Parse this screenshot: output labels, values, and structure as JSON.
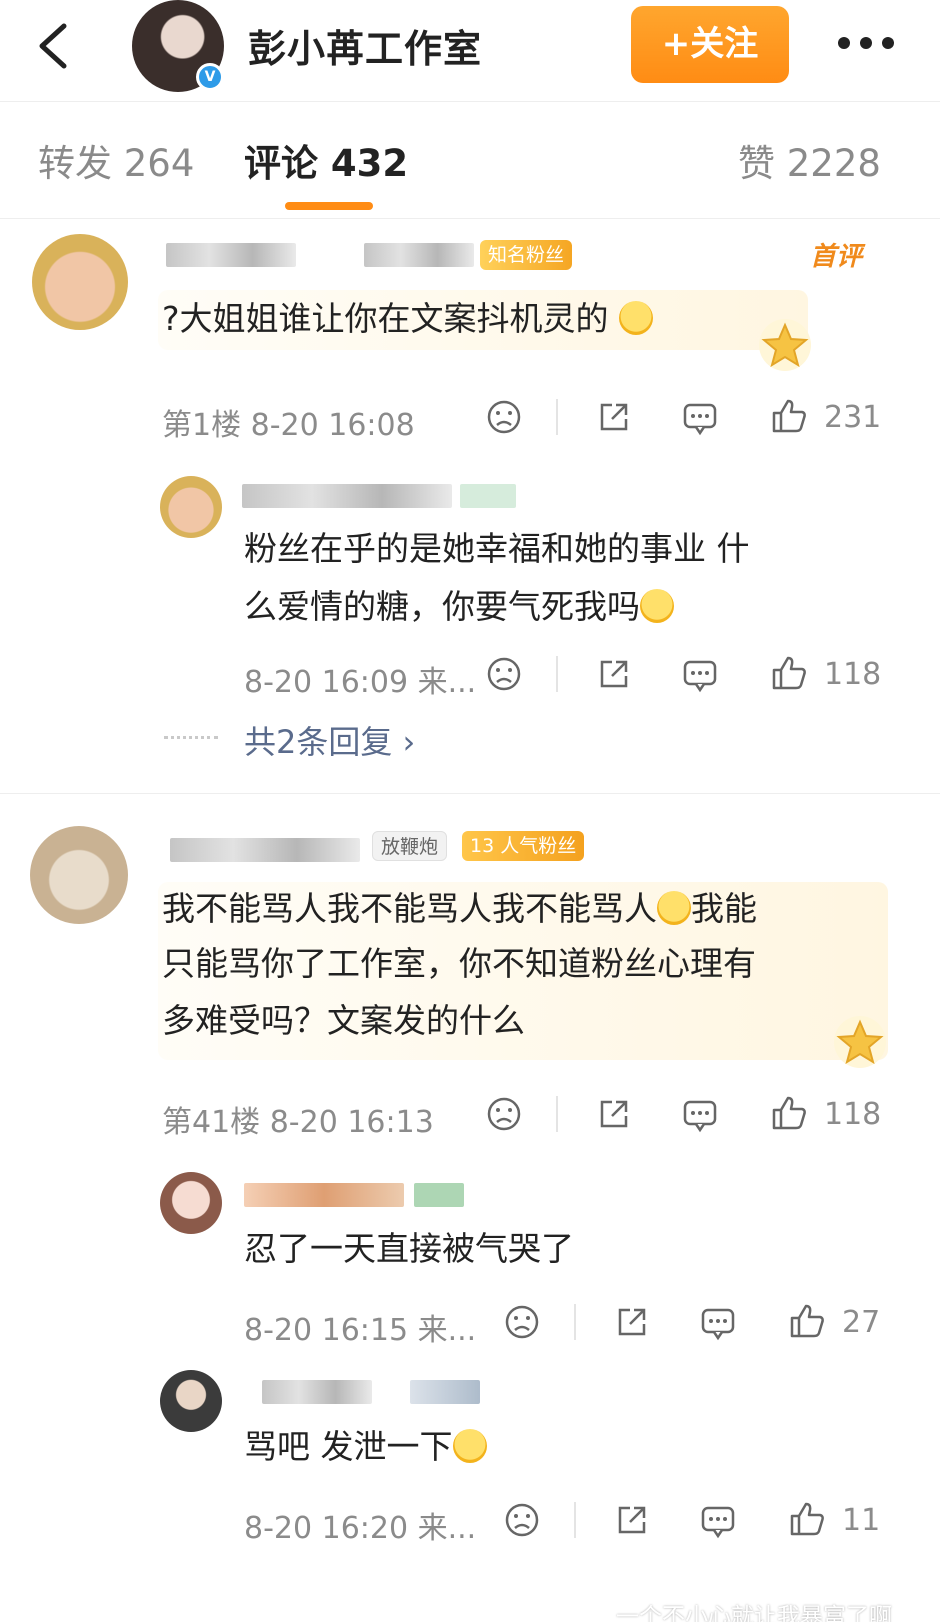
{
  "header": {
    "title": "彭小苒工作室",
    "follow_label": "+关注",
    "verified_mark": "V"
  },
  "tabs": [
    {
      "label": "转发 264"
    },
    {
      "label": "评论 432"
    },
    {
      "label": "赞 2228"
    }
  ],
  "comments": [
    {
      "badge": "知名粉丝",
      "first_tag": "首评",
      "text": "?大姐姐谁让你在文案抖机灵的",
      "meta": "第1楼 8-20 16:08",
      "likes": "231",
      "replies": [
        {
          "text_line1": "粉丝在乎的是她幸福和她的事业  什",
          "text_line2": "么爱情的糖，你要气死我吗",
          "meta": "8-20 16:09 来...",
          "likes": "118"
        }
      ],
      "more_replies": "共2条回复 ›"
    },
    {
      "nickname_tag": "放鞭炮",
      "badge_level": "13",
      "badge": "人气粉丝",
      "text_line1": "我不能骂人我不能骂人我不能骂人",
      "text_line1_tail": "我能",
      "text_line2": "只能骂你了工作室，你不知道粉丝心理有",
      "text_line3": "多难受吗？文案发的什么",
      "meta": "第41楼 8-20 16:13",
      "likes": "118",
      "replies": [
        {
          "text": "忍了一天直接被气哭了",
          "meta": "8-20 16:15 来...",
          "likes": "27"
        },
        {
          "text": "骂吧 发泄一下",
          "meta": "8-20 16:20 来...",
          "likes": "11"
        }
      ]
    }
  ],
  "watermark": "一个不小心就让我暴富了啊",
  "colors": {
    "accent": "#ff8c14",
    "link": "#5a6b8c",
    "muted": "#8b8b8b"
  }
}
